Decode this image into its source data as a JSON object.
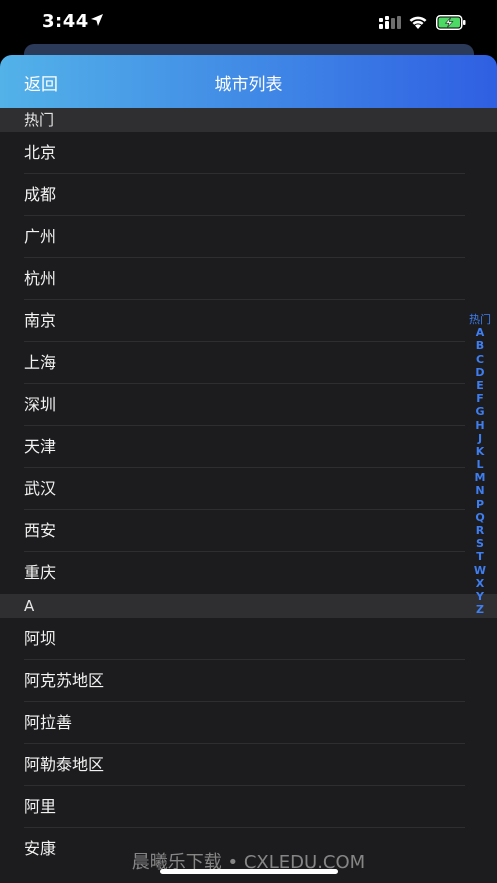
{
  "status_bar": {
    "time": "3:44",
    "icons": [
      "location-arrow-icon",
      "signal-icon",
      "wifi-icon",
      "battery-charging-icon"
    ]
  },
  "nav": {
    "back_label": "返回",
    "title": "城市列表"
  },
  "sections": [
    {
      "header": "热门",
      "cities": [
        "北京",
        "成都",
        "广州",
        "杭州",
        "南京",
        "上海",
        "深圳",
        "天津",
        "武汉",
        "西安",
        "重庆"
      ]
    },
    {
      "header": "A",
      "cities": [
        "阿坝",
        "阿克苏地区",
        "阿拉善",
        "阿勒泰地区",
        "阿里",
        "安康"
      ]
    }
  ],
  "index": [
    "热门",
    "A",
    "B",
    "C",
    "D",
    "E",
    "F",
    "G",
    "H",
    "J",
    "K",
    "L",
    "M",
    "N",
    "P",
    "Q",
    "R",
    "S",
    "T",
    "W",
    "X",
    "Y",
    "Z"
  ],
  "watermark": "晨曦乐下载 • CXLEDU.COM",
  "colors": {
    "nav_gradient_start": "#53b2e8",
    "nav_gradient_end": "#2f5fe2",
    "index_accent": "#3f7ef0",
    "list_background": "#1c1c1e",
    "section_header_background": "#2f2f31"
  }
}
